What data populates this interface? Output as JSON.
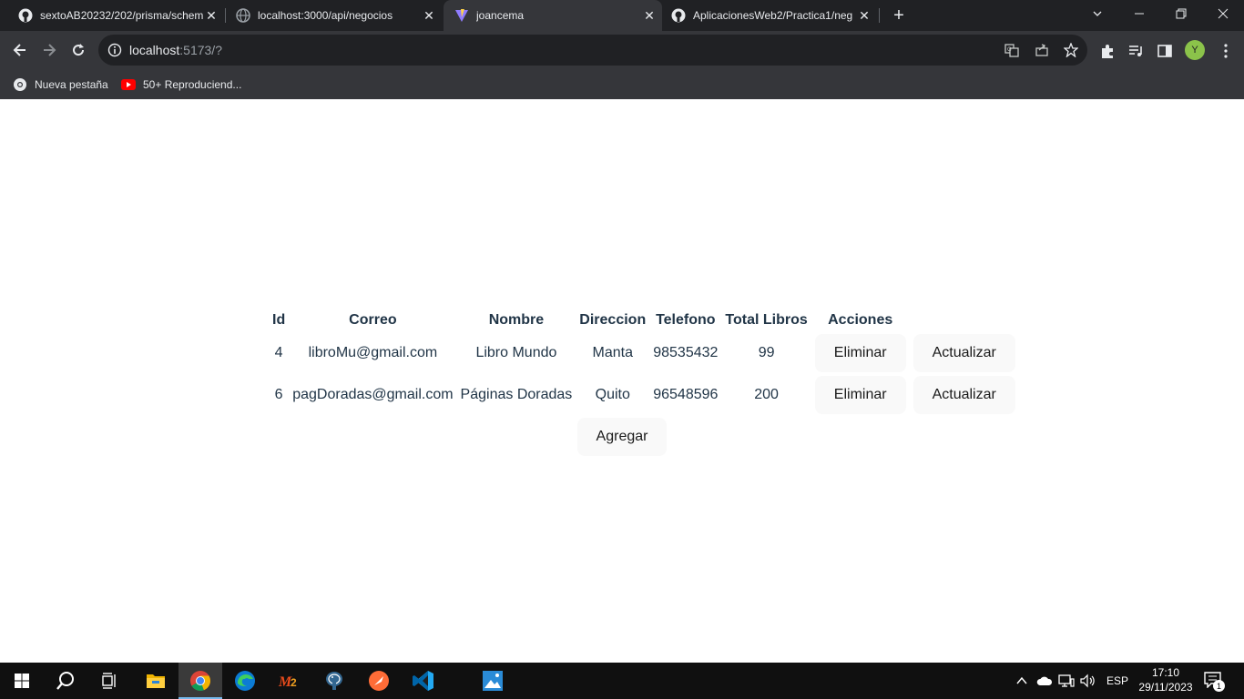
{
  "browser": {
    "tabs": [
      {
        "title": "sextoAB20232/202/prisma/schem",
        "favicon": "github-icon"
      },
      {
        "title": "localhost:3000/api/negocios",
        "favicon": "globe-icon"
      },
      {
        "title": "joancema",
        "favicon": "vite-icon",
        "active": true
      },
      {
        "title": "AplicacionesWeb2/Practica1/neg",
        "favicon": "github-icon"
      }
    ],
    "address": {
      "host": "localhost",
      "rest": ":5173/?"
    },
    "bookmarks": [
      {
        "label": "Nueva pestaña",
        "icon": "chrome-icon"
      },
      {
        "label": "50+ Reproduciend...",
        "icon": "youtube-icon"
      }
    ],
    "profile_initial": "Y"
  },
  "table": {
    "headers": [
      "Id",
      "Correo",
      "Nombre",
      "Direccion",
      "Telefono",
      "Total Libros",
      "Acciones"
    ],
    "rows": [
      {
        "id": "4",
        "correo": "libroMu@gmail.com",
        "nombre": "Libro Mundo",
        "direccion": "Manta",
        "telefono": "98535432",
        "total": "99"
      },
      {
        "id": "6",
        "correo": "pagDoradas@gmail.com",
        "nombre": "Páginas Doradas",
        "direccion": "Quito",
        "telefono": "96548596",
        "total": "200"
      }
    ],
    "delete_label": "Eliminar",
    "update_label": "Actualizar"
  },
  "add_label": "Agregar",
  "taskbar": {
    "language": "ESP",
    "time": "17:10",
    "date": "29/11/2023",
    "notification_count": "1"
  }
}
